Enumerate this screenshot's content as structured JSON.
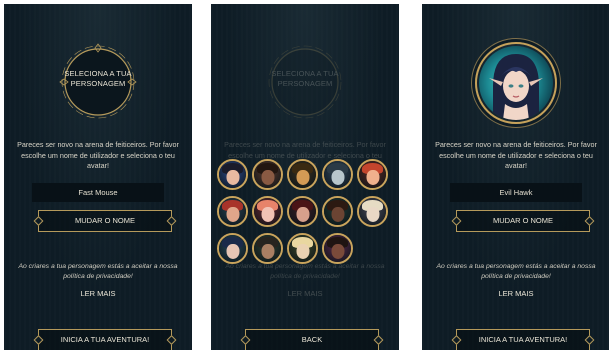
{
  "screen1": {
    "emblem_text": "SELECIONA A TUA PERSONAGEM",
    "intro": "Pareces ser novo na arena de feiticeiros. Por favor escolhe um nome de utilizador e seleciona o teu avatar!",
    "username": "Fast Mouse",
    "change_name_label": "MUDAR O NOME",
    "privacy": "Ao criares a tua personagem estás a aceitar a nossa política de privacidade!",
    "read_more": "LER MAIS",
    "start_label": "INICIA A TUA AVENTURA!"
  },
  "screen2": {
    "emblem_text": "SELECIONA A TUA PERSONAGEM",
    "intro": "Pareces ser novo na arena de feiticeiros. Por favor escolhe um nome de utilizador e seleciona o teu avatar!",
    "privacy": "Ao criares a tua personagem estás a aceitar a nossa política de privacidade!",
    "read_more": "LER MAIS",
    "back_label": "BACK",
    "avatars": [
      {
        "bg": "#2f4a8a",
        "skin": "#e8b9a1",
        "hair": "#1b1b2a"
      },
      {
        "bg": "#5a3a2c",
        "skin": "#8a5a43",
        "hair": "#231610"
      },
      {
        "bg": "#3b3220",
        "skin": "#d39a55",
        "hair": "#3a2a12"
      },
      {
        "bg": "#31465a",
        "skin": "#b8c6cc",
        "hair": "#2b3a46"
      },
      {
        "bg": "#5c2a22",
        "skin": "#f0b08d",
        "hair": "#c4452d"
      },
      {
        "bg": "#2a4250",
        "skin": "#e0a58a",
        "hair": "#a8332a"
      },
      {
        "bg": "#6a2a30",
        "skin": "#f2c2b5",
        "hair": "#e7836a"
      },
      {
        "bg": "#3a1e22",
        "skin": "#d7a08c",
        "hair": "#4a1416"
      },
      {
        "bg": "#1f3a33",
        "skin": "#6b4433",
        "hair": "#2c1a12"
      },
      {
        "bg": "#4a4a58",
        "skin": "#e9d8c6",
        "hair": "#e6dcc4"
      },
      {
        "bg": "#274a5a",
        "skin": "#e6c5b5",
        "hair": "#1a2a4a"
      },
      {
        "bg": "#2f4032",
        "skin": "#a97f63",
        "hair": "#27241f"
      },
      {
        "bg": "#3f4a2a",
        "skin": "#ead2b2",
        "hair": "#e9d7a0"
      },
      {
        "bg": "#5a2a4a",
        "skin": "#7a4a3a",
        "hair": "#1f1412"
      }
    ]
  },
  "screen3": {
    "intro": "Pareces ser novo na arena de feiticeiros. Por favor escolhe um nome de utilizador e seleciona o teu avatar!",
    "username": "Evil Hawk",
    "change_name_label": "MUDAR O NOME",
    "privacy": "Ao criares a tua personagem estás a aceitar a nossa política de privacidade!",
    "read_more": "LER MAIS",
    "start_label": "INICIA A TUA AVENTURA!"
  },
  "colors": {
    "background": "#0e1c25",
    "accent_gold": "#b59a5b",
    "text": "#e8e3d4"
  }
}
